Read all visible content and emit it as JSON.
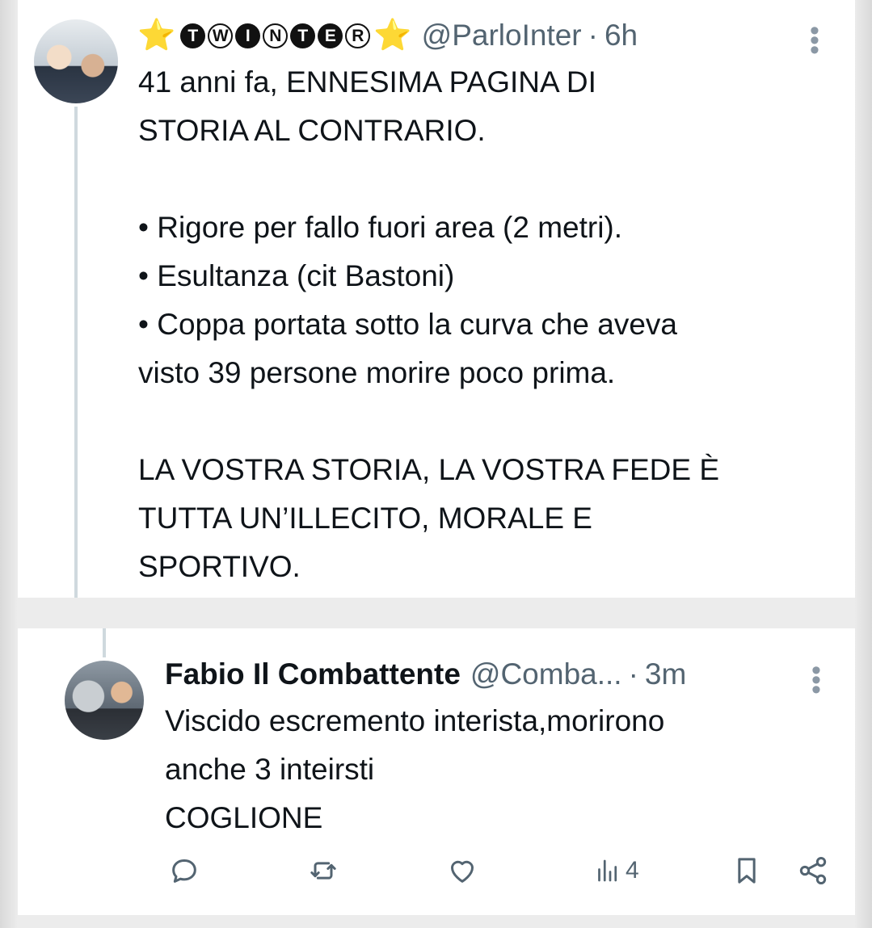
{
  "tweet": {
    "display_name_stars": [
      "⭐",
      "⭐"
    ],
    "display_name_badges": [
      "T",
      "W",
      "I",
      "N",
      "T",
      "E",
      "R"
    ],
    "handle": "@ParloInter",
    "separator": "·",
    "time": "6h",
    "text": "41 anni fa, ENNESIMA PAGINA DI\nSTORIA AL CONTRARIO.\n\n• Rigore per fallo fuori area (2 metri).\n• Esultanza (cit Bastoni)\n• Coppa portata sotto la curva che aveva\nvisto 39 persone morire poco prima.\n\nLA VOSTRA STORIA, LA VOSTRA FEDE È\nTUTTA UN’ILLECITO, MORALE E\nSPORTIVO."
  },
  "reply": {
    "display_name": "Fabio Il Combattente",
    "handle": "@Comba...",
    "separator": "·",
    "time": "3m",
    "text": "Viscido escremento interista,morirono\nanche 3 inteirsti\nCOGLIONE",
    "actions": {
      "reply_icon": "speech-bubble-icon",
      "retweet_icon": "retweet-icon",
      "like_icon": "heart-icon",
      "views_icon": "bar-chart-icon",
      "views_count": "4",
      "bookmark_icon": "bookmark-icon",
      "share_icon": "share-icon"
    }
  },
  "colors": {
    "text_primary": "#0f1419",
    "text_secondary": "#536471",
    "star": "#f5b800",
    "thread_line": "#cfd9de"
  }
}
